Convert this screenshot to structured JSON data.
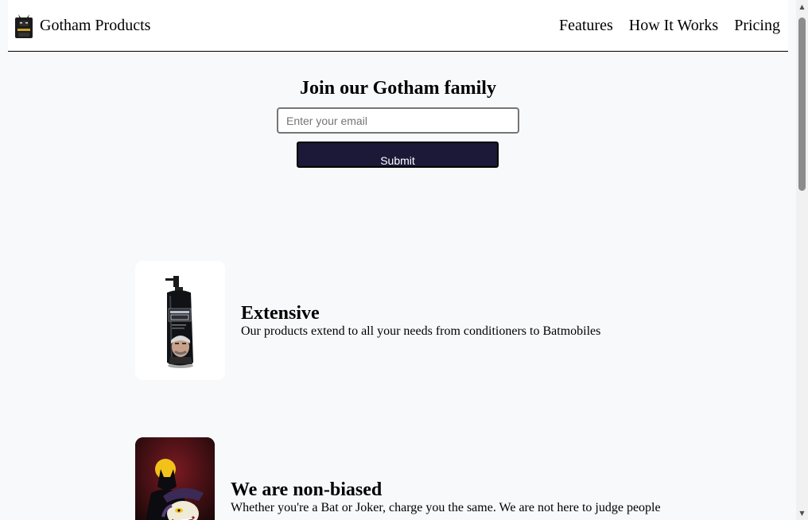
{
  "header": {
    "brand": "Gotham Products",
    "logo_icon": "batman-logo-icon",
    "nav": [
      {
        "label": "Features"
      },
      {
        "label": "How It Works"
      },
      {
        "label": "Pricing"
      }
    ]
  },
  "signup": {
    "title": "Join our Gotham family",
    "email_placeholder": "Enter your email",
    "email_value": "",
    "submit_label": "Submit"
  },
  "features": [
    {
      "image": "conditioner-bottle-image",
      "title": "Extensive",
      "text": "Our products extend to all your needs from conditioners to Batmobiles"
    },
    {
      "image": "batman-joker-image",
      "title": "We are non-biased",
      "text": "Whether you're a Bat or Joker, charge you the same. We are not here to judge people"
    }
  ],
  "colors": {
    "page_background": "#f8f9fa",
    "header_background": "#ffffff",
    "submit_background": "#1c1838",
    "submit_text": "#ffffff"
  }
}
